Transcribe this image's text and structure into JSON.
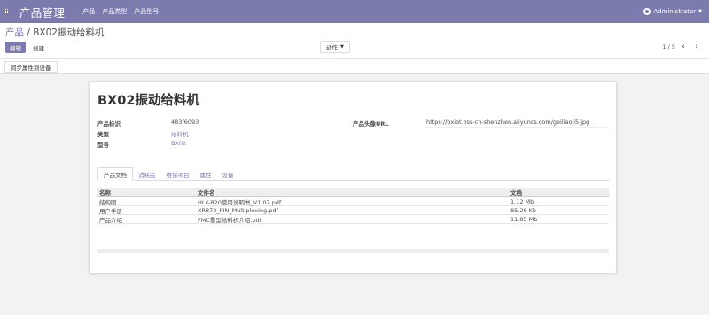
{
  "navbar": {
    "brand": "产品管理",
    "menu": [
      "产品",
      "产品类型",
      "产品型号"
    ],
    "user": "Administrator",
    "accent": "#7c7bad"
  },
  "breadcrumb": {
    "parent": "产品",
    "separator": " / ",
    "current": "BX02振动给料机"
  },
  "buttons": {
    "edit": "编辑",
    "create": "创建",
    "action": "动作",
    "sync": "同步属性到设备"
  },
  "pager": {
    "value": "1 / 5",
    "prev": "‹",
    "next": "›"
  },
  "form": {
    "title": "BX02振动给料机",
    "fields": {
      "product_id_label": "产品标识",
      "product_id": "483f6093",
      "type_label": "类型",
      "type": "给料机",
      "model_label": "型号",
      "model": "BX02",
      "avatar_url_label": "产品头像URL",
      "avatar_url": "https://bxiot.oss-cn-shenzhen.aliyuncs.com/geiliaoji5.jpg"
    },
    "tabs": [
      "产品文档",
      "消耗品",
      "维保项目",
      "属性",
      "设备"
    ],
    "active_tab": 0
  },
  "docs_table": {
    "headers": [
      "名称",
      "文件名",
      "文档"
    ],
    "rows": [
      [
        "结构图",
        "HLK-B20使用说明书_V1.07.pdf",
        "1.12 Mb"
      ],
      [
        "用户手册",
        "XR872_PIN_Multiplexing.pdf",
        "85.26 Kb"
      ],
      [
        "产品介绍",
        "FMC重型给料机介绍.pdf",
        "11.85 Mb"
      ]
    ]
  }
}
